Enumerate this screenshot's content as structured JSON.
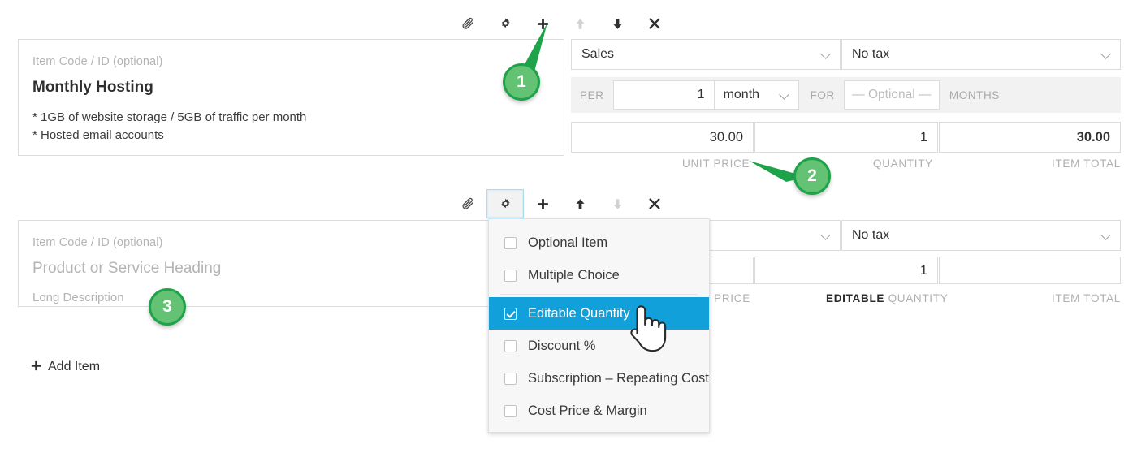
{
  "rows": [
    {
      "toolbar": {
        "attach": "attach",
        "settings": "settings",
        "add": "add",
        "move_up": "move-up",
        "move_down": "move-down",
        "remove": "remove"
      },
      "item_code_placeholder": "Item Code / ID (optional)",
      "title": "Monthly Hosting",
      "description_lines": [
        "* 1GB of website storage / 5GB of traffic per month",
        "* Hosted email accounts"
      ],
      "account": "Sales",
      "tax": "No tax",
      "subscription": {
        "per_label": "PER",
        "per_qty": "1",
        "per_unit": "month",
        "for_label": "FOR",
        "for_value": "— Optional —",
        "months_label": "MONTHS"
      },
      "unit_price": "30.00",
      "quantity": "1",
      "item_total": "30.00",
      "captions": {
        "unit_price": "UNIT PRICE",
        "quantity": "QUANTITY",
        "item_total": "ITEM TOTAL"
      }
    },
    {
      "item_code_placeholder": "Item Code / ID (optional)",
      "title_placeholder": "Product or Service Heading",
      "description_placeholder": "Long Description",
      "tax": "No tax",
      "unit_price": "",
      "quantity": "1",
      "item_total": "",
      "captions": {
        "unit_price": "T PRICE",
        "quantity_prefix": "EDITABLE",
        "quantity": "QUANTITY",
        "item_total": "ITEM TOTAL"
      }
    }
  ],
  "menu": {
    "items": [
      {
        "label": "Optional Item",
        "checked": false
      },
      {
        "label": "Multiple Choice",
        "checked": false
      },
      {
        "label": "Editable Quantity",
        "checked": true
      },
      {
        "label": "Discount %",
        "checked": false
      },
      {
        "label": "Subscription – Repeating Cost",
        "checked": false
      },
      {
        "label": "Cost Price & Margin",
        "checked": false
      }
    ]
  },
  "add_item": {
    "icon": "+",
    "label": "Add Item"
  },
  "callouts": [
    {
      "number": "1"
    },
    {
      "number": "2"
    },
    {
      "number": "3"
    }
  ],
  "colors": {
    "accent_blue": "#12a0da",
    "badge_fill": "#63c274",
    "badge_ring": "#1ea34a",
    "border": "#dcdcdc",
    "muted_text": "#b0b0b0"
  }
}
